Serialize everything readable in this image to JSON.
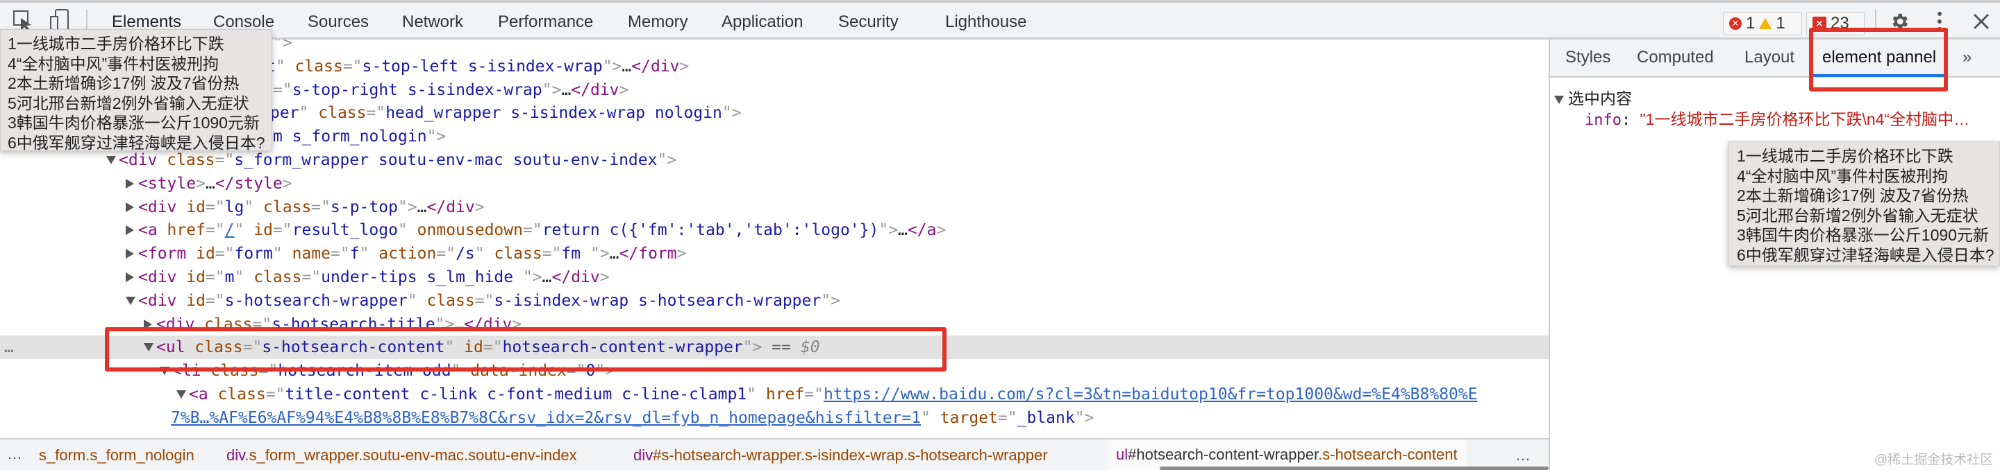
{
  "toolbar": {
    "tabs": [
      "Elements",
      "Console",
      "Sources",
      "Network",
      "Performance",
      "Memory",
      "Application",
      "Security",
      "Lighthouse"
    ],
    "active_tab": "Elements",
    "errors": "1",
    "warnings": "1",
    "issues": "23"
  },
  "tooltip_lines": [
    "1一线城市二手房价格环比下跌",
    "4“全村脑中风”事件村医被刑拘",
    "2本土新增确诊17例 波及7省份热",
    "5河北邢台新增2例外省输入无症状",
    "3韩国牛肉价格暴涨一公斤1090元新",
    "6中俄军舰穿过津轻海峡是入侵日本?"
  ],
  "dom_lines": [
    {
      "toggle": null,
      "tokens": [
        [
          "p",
          "\">"
        ]
      ]
    },
    {
      "toggle": null,
      "tokens": [
        [
          "v",
          "t"
        ],
        [
          "p",
          "\""
        ],
        [
          "a",
          " class"
        ],
        [
          "p",
          "=\""
        ],
        [
          "v",
          "s-top-left s-isindex-wrap"
        ],
        [
          "p",
          "\">"
        ],
        [
          "x",
          "…"
        ],
        [
          "t",
          "</div"
        ],
        [
          "p",
          ">"
        ]
      ]
    },
    {
      "toggle": null,
      "tokens": [
        [
          "p",
          "=\""
        ],
        [
          "v",
          "s-top-right s-isindex-wrap"
        ],
        [
          "p",
          "\">"
        ],
        [
          "x",
          "…"
        ],
        [
          "t",
          "</div"
        ],
        [
          "p",
          ">"
        ]
      ]
    },
    {
      "toggle": null,
      "tokens": [
        [
          "v",
          "per"
        ],
        [
          "p",
          "\""
        ],
        [
          "a",
          " class"
        ],
        [
          "p",
          "=\""
        ],
        [
          "v",
          "head_wrapper s-isindex-wrap nologin"
        ],
        [
          "p",
          "\">"
        ]
      ]
    },
    {
      "toggle": null,
      "tokens": [
        [
          "v",
          "m s_form_nologin"
        ],
        [
          "p",
          "\">"
        ]
      ]
    },
    {
      "toggle": "open",
      "tokens": [
        [
          "t",
          "<div"
        ],
        [
          "a",
          " class"
        ],
        [
          "p",
          "=\""
        ],
        [
          "v",
          "s_form_wrapper soutu-env-mac soutu-env-index"
        ],
        [
          "p",
          "\">"
        ]
      ]
    },
    {
      "toggle": "closed",
      "tokens": [
        [
          "t",
          "<style"
        ],
        [
          "p",
          ">"
        ],
        [
          "x",
          "…"
        ],
        [
          "t",
          "</style"
        ],
        [
          "p",
          ">"
        ]
      ]
    },
    {
      "toggle": "closed",
      "tokens": [
        [
          "t",
          "<div"
        ],
        [
          "a",
          " id"
        ],
        [
          "p",
          "=\""
        ],
        [
          "v",
          "lg"
        ],
        [
          "p",
          "\""
        ],
        [
          "a",
          " class"
        ],
        [
          "p",
          "=\""
        ],
        [
          "v",
          "s-p-top"
        ],
        [
          "p",
          "\">"
        ],
        [
          "x",
          "…"
        ],
        [
          "t",
          "</div"
        ],
        [
          "p",
          ">"
        ]
      ]
    },
    {
      "toggle": "closed",
      "tokens": [
        [
          "t",
          "<a"
        ],
        [
          "a",
          " href"
        ],
        [
          "p",
          "=\""
        ],
        [
          "l",
          "/"
        ],
        [
          "p",
          "\""
        ],
        [
          "a",
          " id"
        ],
        [
          "p",
          "=\""
        ],
        [
          "v",
          "result_logo"
        ],
        [
          "p",
          "\""
        ],
        [
          "a",
          " onmousedown"
        ],
        [
          "p",
          "=\""
        ],
        [
          "v",
          "return c({'fm':'tab','tab':'logo'})"
        ],
        [
          "p",
          "\">"
        ],
        [
          "x",
          "…"
        ],
        [
          "t",
          "</a"
        ],
        [
          "p",
          ">"
        ]
      ]
    },
    {
      "toggle": "closed",
      "tokens": [
        [
          "t",
          "<form"
        ],
        [
          "a",
          " id"
        ],
        [
          "p",
          "=\""
        ],
        [
          "v",
          "form"
        ],
        [
          "p",
          "\""
        ],
        [
          "a",
          " name"
        ],
        [
          "p",
          "=\""
        ],
        [
          "v",
          "f"
        ],
        [
          "p",
          "\""
        ],
        [
          "a",
          " action"
        ],
        [
          "p",
          "=\""
        ],
        [
          "v",
          "/s"
        ],
        [
          "p",
          "\""
        ],
        [
          "a",
          " class"
        ],
        [
          "p",
          "=\""
        ],
        [
          "v",
          "fm "
        ],
        [
          "p",
          "\">"
        ],
        [
          "x",
          "…"
        ],
        [
          "t",
          "</form"
        ],
        [
          "p",
          ">"
        ]
      ]
    },
    {
      "toggle": "closed",
      "tokens": [
        [
          "t",
          "<div"
        ],
        [
          "a",
          " id"
        ],
        [
          "p",
          "=\""
        ],
        [
          "v",
          "m"
        ],
        [
          "p",
          "\""
        ],
        [
          "a",
          " class"
        ],
        [
          "p",
          "=\""
        ],
        [
          "v",
          "under-tips s_lm_hide "
        ],
        [
          "p",
          "\">"
        ],
        [
          "x",
          "…"
        ],
        [
          "t",
          "</div"
        ],
        [
          "p",
          ">"
        ]
      ]
    },
    {
      "toggle": "open",
      "tokens": [
        [
          "t",
          "<div"
        ],
        [
          "a",
          " id"
        ],
        [
          "p",
          "=\""
        ],
        [
          "v",
          "s-hotsearch-wrapper"
        ],
        [
          "p",
          "\""
        ],
        [
          "a",
          " class"
        ],
        [
          "p",
          "=\""
        ],
        [
          "v",
          "s-isindex-wrap s-hotsearch-wrapper"
        ],
        [
          "p",
          "\">"
        ]
      ]
    },
    {
      "toggle": "closed",
      "tokens": [
        [
          "t",
          "<div"
        ],
        [
          "a",
          " class"
        ],
        [
          "p",
          "=\""
        ],
        [
          "v",
          "s-hotsearch-title"
        ],
        [
          "p",
          "\">"
        ],
        [
          "x",
          "…"
        ],
        [
          "t",
          "</div"
        ],
        [
          "p",
          ">"
        ]
      ]
    },
    {
      "toggle": "open",
      "selected": true,
      "tokens": [
        [
          "t",
          "<ul"
        ],
        [
          "a",
          " class"
        ],
        [
          "p",
          "=\""
        ],
        [
          "v",
          "s-hotsearch-content"
        ],
        [
          "p",
          "\""
        ],
        [
          "a",
          " id"
        ],
        [
          "p",
          "=\""
        ],
        [
          "v",
          "hotsearch-content-wrapper"
        ],
        [
          "p",
          "\">"
        ],
        [
          "s",
          " == "
        ],
        [
          "d",
          "$0"
        ]
      ]
    },
    {
      "toggle": "open",
      "tokens": [
        [
          "t",
          "<li"
        ],
        [
          "a",
          " class"
        ],
        [
          "p",
          "=\""
        ],
        [
          "v",
          "hotsearch-item odd"
        ],
        [
          "p",
          "\""
        ],
        [
          "a",
          " data-index"
        ],
        [
          "p",
          "=\""
        ],
        [
          "v",
          "0"
        ],
        [
          "p",
          "\">"
        ]
      ]
    },
    {
      "toggle": "open",
      "tokens": [
        [
          "t",
          "<a"
        ],
        [
          "a",
          " class"
        ],
        [
          "p",
          "=\""
        ],
        [
          "v",
          "title-content c-link c-font-medium c-line-clamp1"
        ],
        [
          "p",
          "\""
        ],
        [
          "a",
          " href"
        ],
        [
          "p",
          "=\""
        ],
        [
          "l",
          "https://www.baidu.com/s?cl=3&tn=baidutop10&fr=top1000&wd=%E4%B8%80%E"
        ]
      ]
    },
    {
      "toggle": null,
      "tokens": [
        [
          "l",
          "7%B…%AF%E6%AF%94%E4%B8%8B%E8%B7%8C&rsv_idx=2&rsv_dl=fyb_n_homepage&hisfilter=1"
        ],
        [
          "p",
          "\""
        ],
        [
          "a",
          " target"
        ],
        [
          "p",
          "=\""
        ],
        [
          "v",
          "_blank"
        ],
        [
          "p",
          "\">"
        ]
      ]
    }
  ],
  "breadcrumbs": [
    {
      "tag": "",
      "rest": "s_form.s_form_nologin"
    },
    {
      "tag": "div",
      "rest": ".s_form_wrapper.soutu-env-mac.soutu-env-index"
    },
    {
      "tag": "div",
      "rest": "#s-hotsearch-wrapper.s-isindex-wrap.s-hotsearch-wrapper"
    },
    {
      "tag": "ul",
      "id": "#hotsearch-content-wrapper",
      "cls": ".s-hotsearch-content"
    }
  ],
  "breadcrumb_more": "…",
  "row_more": "…",
  "sidebar": {
    "tabs": [
      "Styles",
      "Computed",
      "Layout",
      "element pannel"
    ],
    "active_tab": "element pannel",
    "more": "»",
    "section_title": "选中内容",
    "info_key": "info",
    "info_value": "\"1一线城市二手房价格环比下跌\\n4“全村脑中…"
  },
  "watermark": "@稀土掘金技术社区",
  "colors": {
    "highlight_box": "#e0342a",
    "active_tab_underline": "#1a73e8"
  }
}
